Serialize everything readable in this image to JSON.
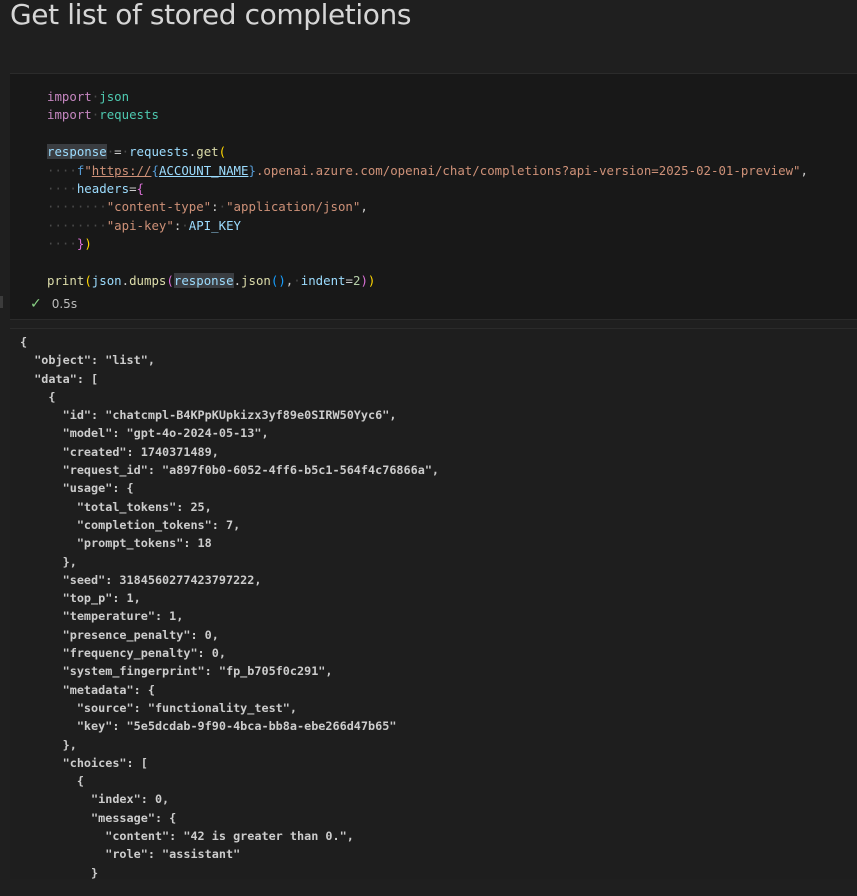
{
  "page": {
    "title": "Get list of stored completions"
  },
  "code_cell": {
    "lines": [
      "import json",
      "import requests",
      "",
      "response = requests.get(",
      "    f\"https://{ACCOUNT_NAME}.openai.azure.com/openai/chat/completions?api-version=2025-02-01-preview\",",
      "    headers={",
      "        \"content-type\": \"application/json\",",
      "        \"api-key\": API_KEY",
      "    })",
      "",
      "print(json.dumps(response.json(), indent=2))"
    ],
    "status_icon": "check-icon",
    "duration": "0.5s",
    "status_color": "#89d185"
  },
  "output": {
    "lines": [
      "{",
      "  \"object\": \"list\",",
      "  \"data\": [",
      "    {",
      "      \"id\": \"chatcmpl-B4KPpKUpkizx3yf89e0SIRW50Yyc6\",",
      "      \"model\": \"gpt-4o-2024-05-13\",",
      "      \"created\": 1740371489,",
      "      \"request_id\": \"a897f0b0-6052-4ff6-b5c1-564f4c76866a\",",
      "      \"usage\": {",
      "        \"total_tokens\": 25,",
      "        \"completion_tokens\": 7,",
      "        \"prompt_tokens\": 18",
      "      },",
      "      \"seed\": 3184560277423797222,",
      "      \"top_p\": 1,",
      "      \"temperature\": 1,",
      "      \"presence_penalty\": 0,",
      "      \"frequency_penalty\": 0,",
      "      \"system_fingerprint\": \"fp_b705f0c291\",",
      "      \"metadata\": {",
      "        \"source\": \"functionality_test\",",
      "        \"key\": \"5e5dcdab-9f90-4bca-bb8a-ebe266d47b65\"",
      "      },",
      "      \"choices\": [",
      "        {",
      "          \"index\": 0,",
      "          \"message\": {",
      "            \"content\": \"42 is greater than 0.\",",
      "            \"role\": \"assistant\"",
      "          }"
    ]
  }
}
